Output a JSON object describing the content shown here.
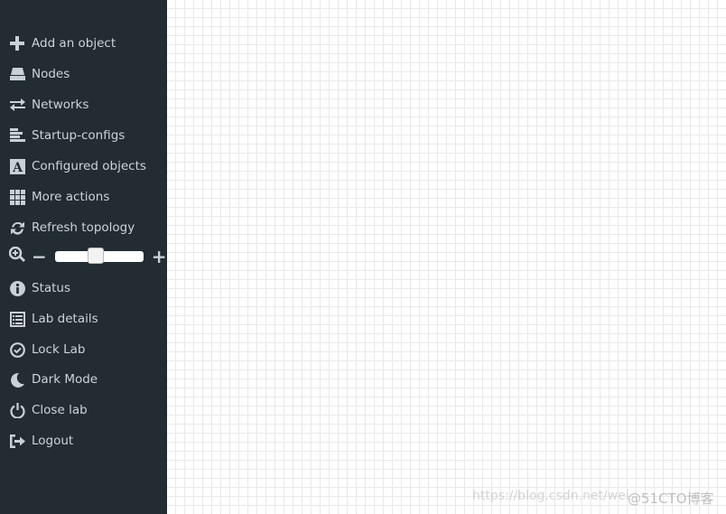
{
  "sidebar": {
    "items": [
      {
        "label": "Add an object",
        "icon": "plus-icon"
      },
      {
        "label": "Nodes",
        "icon": "hdd-icon"
      },
      {
        "label": "Networks",
        "icon": "exchange-icon"
      },
      {
        "label": "Startup-configs",
        "icon": "align-left-icon"
      },
      {
        "label": "Configured objects",
        "icon": "font-icon"
      },
      {
        "label": "More actions",
        "icon": "grid-icon"
      },
      {
        "label": "Refresh topology",
        "icon": "refresh-icon"
      },
      {
        "label": "Status",
        "icon": "info-icon"
      },
      {
        "label": "Lab details",
        "icon": "list-icon"
      },
      {
        "label": "Lock Lab",
        "icon": "check-circle-icon"
      },
      {
        "label": "Dark Mode",
        "icon": "moon-icon"
      },
      {
        "label": "Close lab",
        "icon": "power-icon"
      },
      {
        "label": "Logout",
        "icon": "logout-icon"
      }
    ],
    "zoom": {
      "minus": "−",
      "plus": "+",
      "value_percent": 47
    }
  },
  "watermark": {
    "url": "https://blog.csdn.net/wei",
    "brand": "@51CTO博客"
  },
  "colors": {
    "sidebar_bg": "#222c32",
    "text": "#cdd4d8",
    "grid": "#e9e9e9"
  }
}
